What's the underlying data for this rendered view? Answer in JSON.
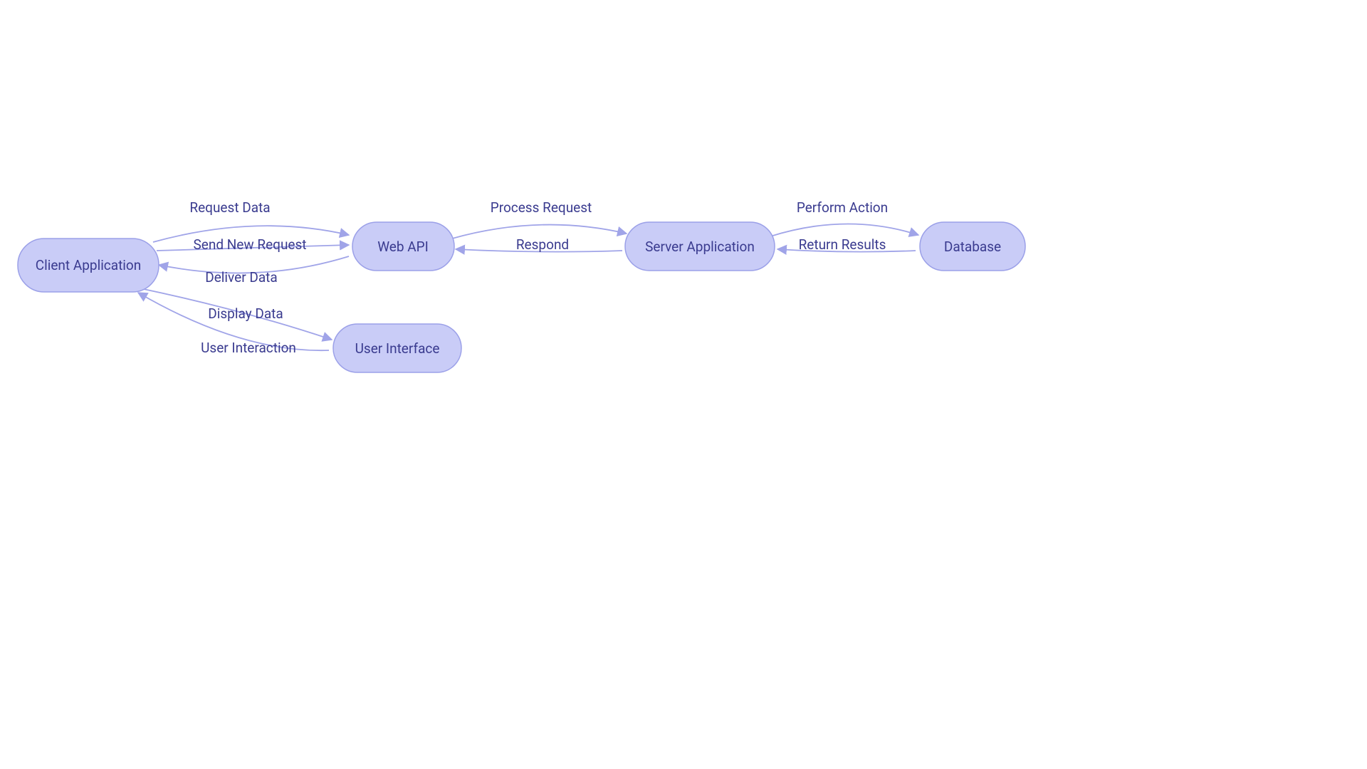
{
  "nodes": {
    "client": {
      "label": "Client Application"
    },
    "webapi": {
      "label": "Web API"
    },
    "server": {
      "label": "Server Application"
    },
    "database": {
      "label": "Database"
    },
    "ui": {
      "label": "User Interface"
    }
  },
  "edges": {
    "request_data": {
      "label": "Request Data"
    },
    "send_new_request": {
      "label": "Send New Request"
    },
    "deliver_data": {
      "label": "Deliver Data"
    },
    "process_request": {
      "label": "Process Request"
    },
    "respond": {
      "label": "Respond"
    },
    "perform_action": {
      "label": "Perform Action"
    },
    "return_results": {
      "label": "Return Results"
    },
    "display_data": {
      "label": "Display Data"
    },
    "user_interaction": {
      "label": "User Interaction"
    }
  }
}
